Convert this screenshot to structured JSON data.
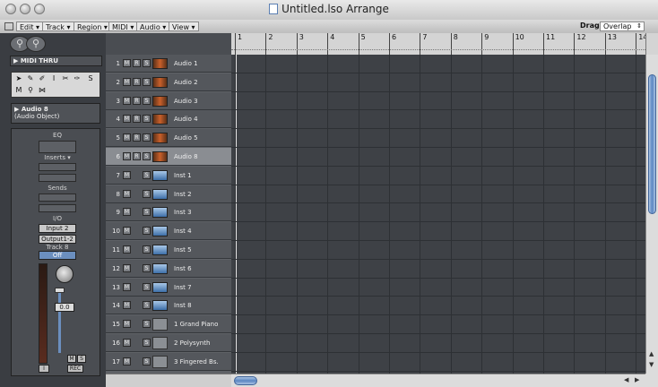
{
  "window": {
    "title": "Untitled.lso Arrange"
  },
  "menubar": {
    "items": [
      {
        "label": "Edit ▾"
      },
      {
        "label": "Track ▾"
      },
      {
        "label": "Region ▾"
      },
      {
        "label": "MIDI ▾"
      },
      {
        "label": "Audio ▾"
      },
      {
        "label": "View ▾"
      }
    ],
    "drag_label": "Drag:",
    "drag_value": "Overlap"
  },
  "ruler": {
    "bars": [
      "1",
      "2",
      "3",
      "4",
      "5",
      "6",
      "7",
      "8",
      "9",
      "10",
      "11",
      "12",
      "13",
      "14"
    ]
  },
  "inspector": {
    "midi_thru": "▶ MIDI THRU",
    "object_name": "▶ Audio 8",
    "object_type": "(Audio Object)",
    "channel": {
      "eq": "EQ",
      "inserts": "Inserts ▾",
      "sends": "Sends",
      "io": "I/O",
      "input": "Input 2",
      "output": "Output1-2",
      "track": "Track 8",
      "mode": "Off",
      "volume": "0.0",
      "m": "M",
      "s": "S",
      "rec": "REC",
      "i": "I"
    }
  },
  "tracks": [
    {
      "num": "1",
      "name": "Audio 1",
      "kind": "audio"
    },
    {
      "num": "2",
      "name": "Audio 2",
      "kind": "audio"
    },
    {
      "num": "3",
      "name": "Audio 3",
      "kind": "audio"
    },
    {
      "num": "4",
      "name": "Audio 4",
      "kind": "audio"
    },
    {
      "num": "5",
      "name": "Audio 5",
      "kind": "audio"
    },
    {
      "num": "6",
      "name": "Audio 8",
      "kind": "audio",
      "selected": true
    },
    {
      "num": "7",
      "name": "Inst 1",
      "kind": "inst"
    },
    {
      "num": "8",
      "name": "Inst 2",
      "kind": "inst"
    },
    {
      "num": "9",
      "name": "Inst 3",
      "kind": "inst"
    },
    {
      "num": "10",
      "name": "Inst 4",
      "kind": "inst"
    },
    {
      "num": "11",
      "name": "Inst 5",
      "kind": "inst"
    },
    {
      "num": "12",
      "name": "Inst 6",
      "kind": "inst"
    },
    {
      "num": "13",
      "name": "Inst 7",
      "kind": "inst"
    },
    {
      "num": "14",
      "name": "Inst 8",
      "kind": "inst"
    },
    {
      "num": "15",
      "name": "1  Grand Piano",
      "kind": "other"
    },
    {
      "num": "16",
      "name": "2  Polysynth",
      "kind": "other"
    },
    {
      "num": "17",
      "name": "3  Fingered Bs.",
      "kind": "other"
    }
  ],
  "track_buttons": {
    "m": "M",
    "r": "R",
    "s": "S"
  }
}
